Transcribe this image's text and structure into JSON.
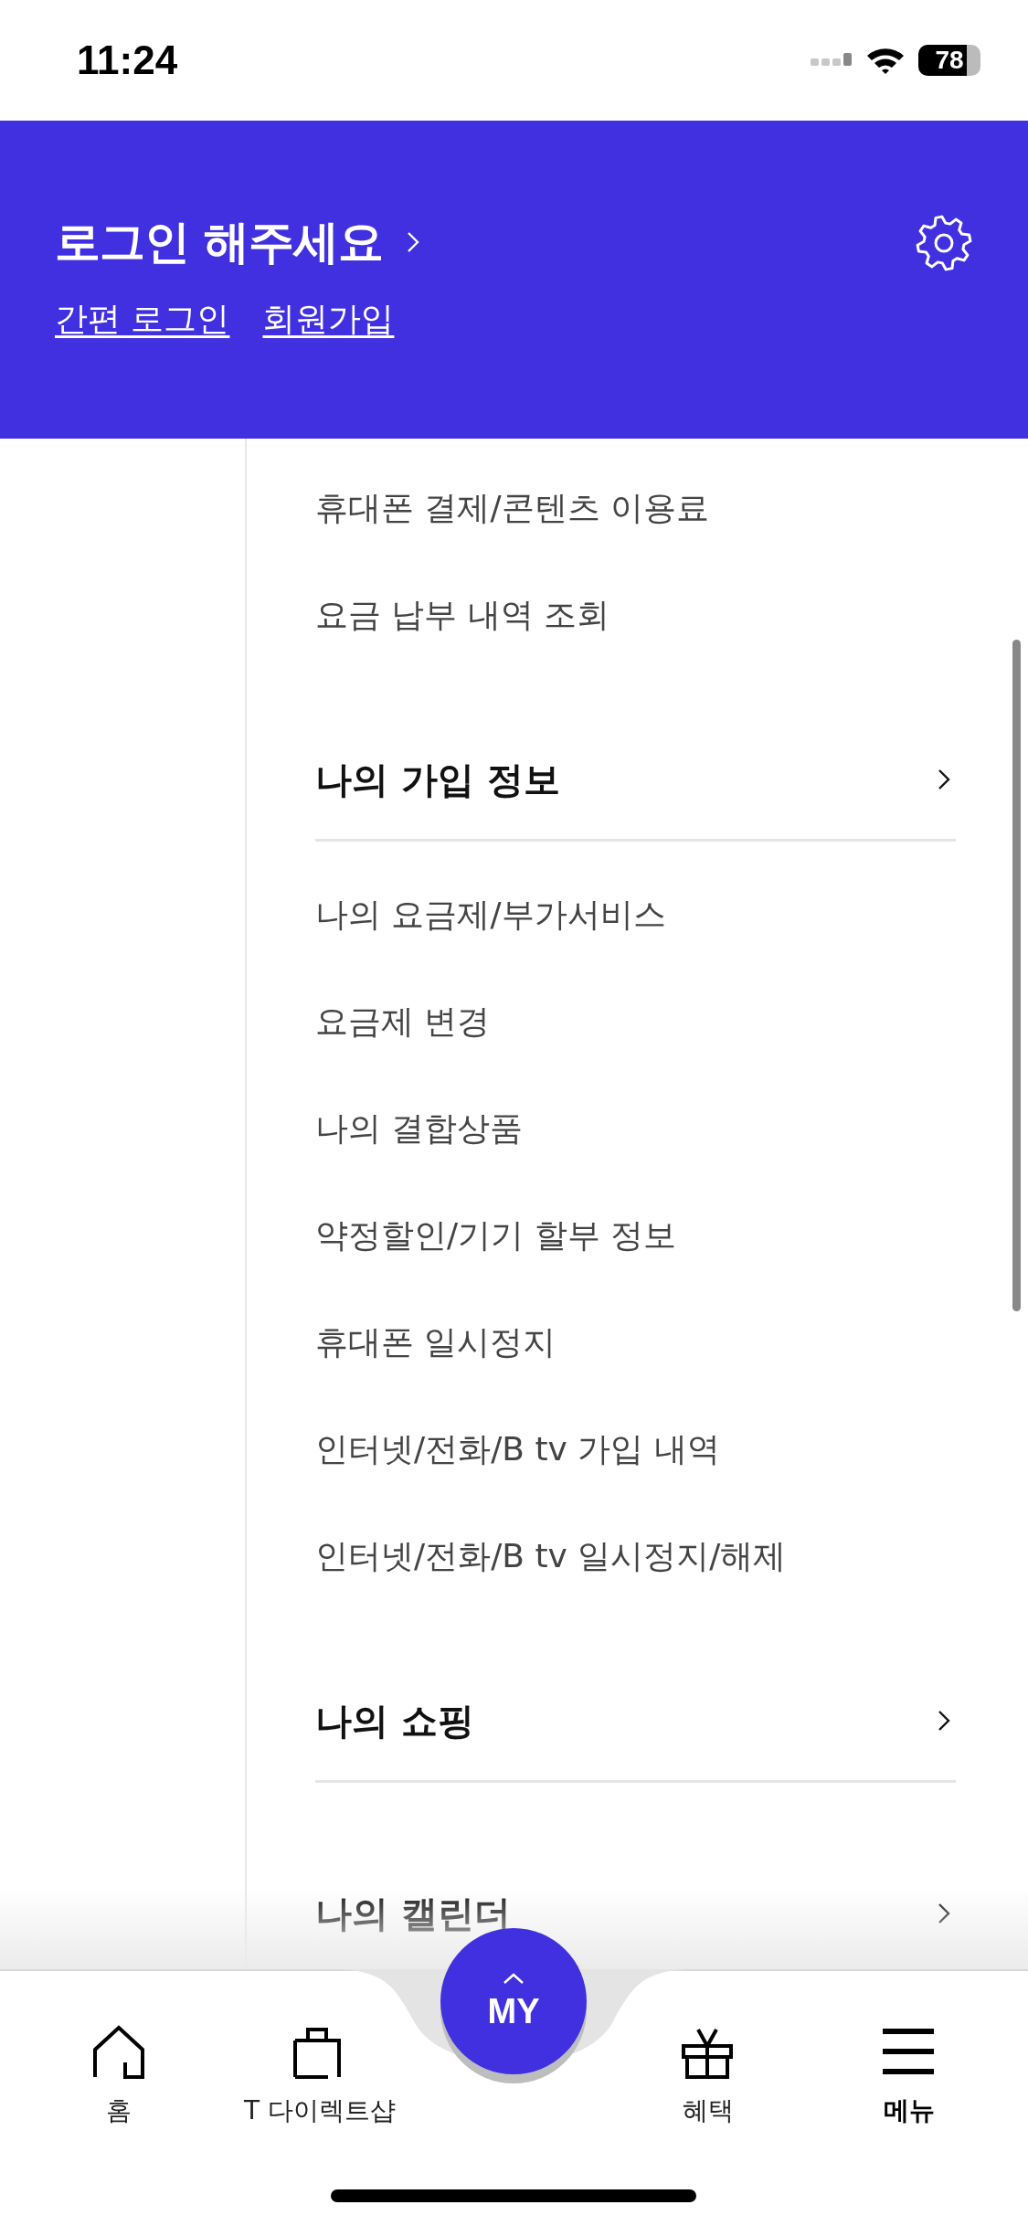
{
  "status_bar": {
    "time": "11:24",
    "battery": "78"
  },
  "header": {
    "title": "로그인 해주세요",
    "links": [
      "간편 로그인",
      "회원가입"
    ]
  },
  "sections": [
    {
      "items": [
        "휴대폰 결제/콘텐츠 이용료",
        "요금 납부 내역 조회"
      ]
    },
    {
      "title": "나의 가입 정보",
      "items": [
        "나의 요금제/부가서비스",
        "요금제 변경",
        "나의 결합상품",
        "약정할인/기기 할부 정보",
        "휴대폰 일시정지",
        "인터넷/전화/B tv 가입 내역",
        "인터넷/전화/B tv 일시정지/해제"
      ]
    },
    {
      "title": "나의 쇼핑"
    },
    {
      "title": "나의 캘린더"
    }
  ],
  "nav": {
    "items": [
      {
        "kind": "home",
        "label": "홈",
        "selected": false
      },
      {
        "kind": "bag",
        "label": "T 다이렉트샵",
        "selected": false
      },
      {
        "kind": "gift",
        "label": "혜택",
        "selected": false
      },
      {
        "kind": "menu",
        "label": "메뉴",
        "selected": true
      }
    ],
    "center": {
      "label": "MY"
    }
  }
}
